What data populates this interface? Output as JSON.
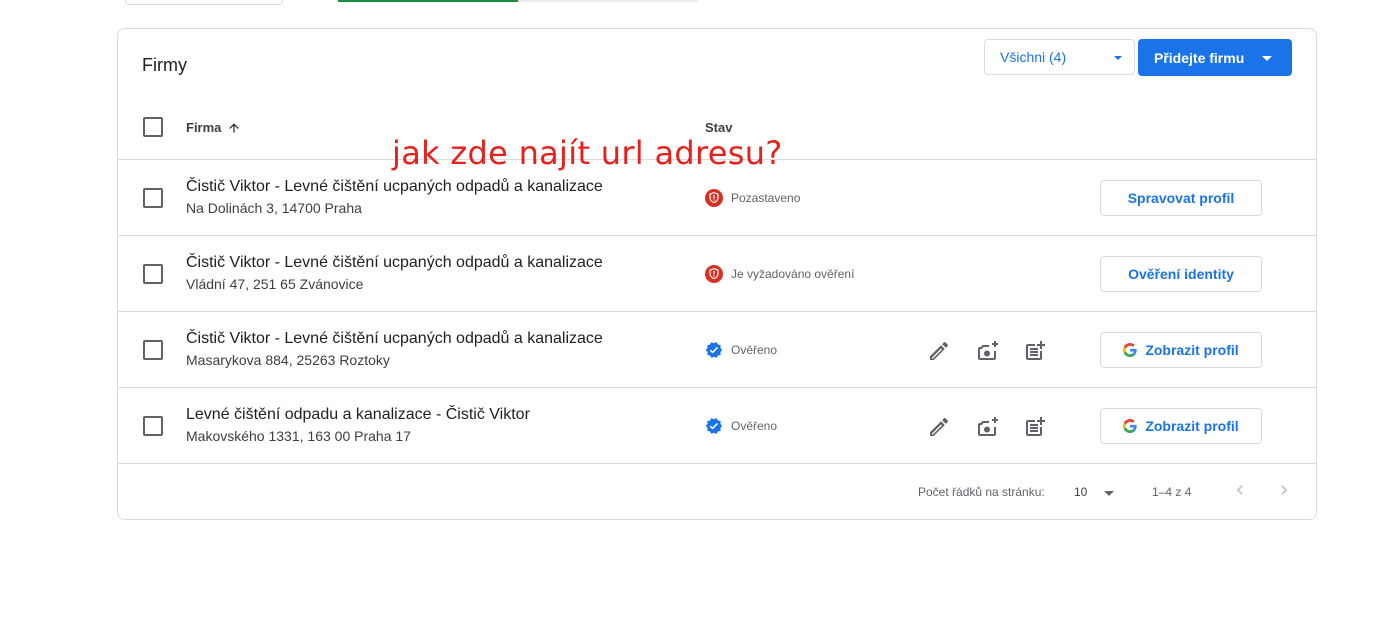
{
  "top_progress": {
    "fraction": 0.5
  },
  "card": {
    "title": "Firmy",
    "filter": {
      "selected": "Všichni (4)"
    },
    "add_button_label": "Přidejte firmu",
    "columns": {
      "firma": "Firma",
      "stav": "Stav"
    }
  },
  "rows": [
    {
      "name": "Čistič Viktor - Levné čištění ucpaných odpadů a kanalizace",
      "address": "Na Dolinách 3, 14700 Praha",
      "status": "Pozastaveno",
      "status_kind": "alert",
      "button_label": "Spravovat profil",
      "button_google": false,
      "actions": false
    },
    {
      "name": "Čistič Viktor - Levné čištění ucpaných odpadů a kanalizace",
      "address": "Vládní 47, 251 65 Zvánovice",
      "status": "Je vyžadováno ověření",
      "status_kind": "alert",
      "button_label": "Ověření identity",
      "button_google": false,
      "actions": false
    },
    {
      "name": "Čistič Viktor - Levné čištění ucpaných odpadů a kanalizace",
      "address": "Masarykova 884, 25263 Roztoky",
      "status": "Ověřeno",
      "status_kind": "verified",
      "button_label": "Zobrazit profil",
      "button_google": true,
      "actions": true
    },
    {
      "name": "Levné čištění odpadu a kanalizace - Čistič Viktor",
      "address": "Makovského 1331, 163 00 Praha 17",
      "status": "Ověřeno",
      "status_kind": "verified",
      "button_label": "Zobrazit profil",
      "button_google": true,
      "actions": true
    }
  ],
  "footer": {
    "rows_per_page_label": "Počet řádků na stránku:",
    "rows_per_page": "10",
    "range": "1–4 z 4"
  },
  "annotation": "jak zde najít url adresu?",
  "colors": {
    "accent": "#1a73e8",
    "alert": "#d93025",
    "verified": "#1a73e8",
    "annotation": "#e8201b"
  }
}
